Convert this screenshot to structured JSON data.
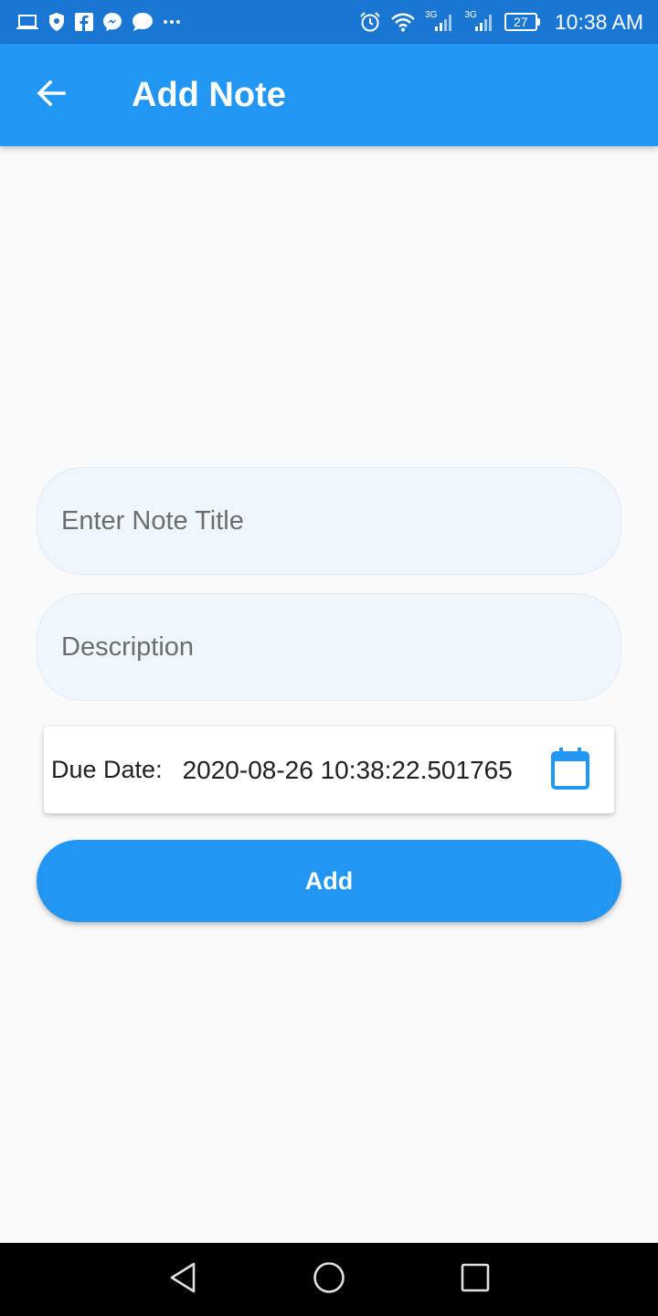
{
  "colors": {
    "primary": "#2196f3",
    "status_bar": "#1976d2",
    "field_bg": "#eff6fd",
    "background": "#fafafa"
  },
  "status_bar": {
    "battery": "27",
    "network_1": "3G",
    "network_2": "3G",
    "time": "10:38 AM",
    "left_icons": [
      "laptop-icon",
      "shield-icon",
      "facebook-icon",
      "messenger-icon",
      "chat-bubble-icon",
      "more-icon"
    ],
    "right_icons": [
      "alarm-icon",
      "wifi-icon",
      "signal-icon",
      "signal-icon",
      "battery-icon"
    ]
  },
  "app_bar": {
    "title": "Add Note",
    "back_icon": "arrow-back-icon"
  },
  "form": {
    "title_placeholder": "Enter Note Title",
    "description_placeholder": "Description",
    "due_date_label": "Due Date:",
    "due_date_value": "2020-08-26 10:38:22.501765",
    "calendar_icon": "calendar-icon",
    "add_label": "Add"
  },
  "nav_bar": {
    "buttons": [
      "back-triangle-icon",
      "home-circle-icon",
      "recents-square-icon"
    ]
  }
}
